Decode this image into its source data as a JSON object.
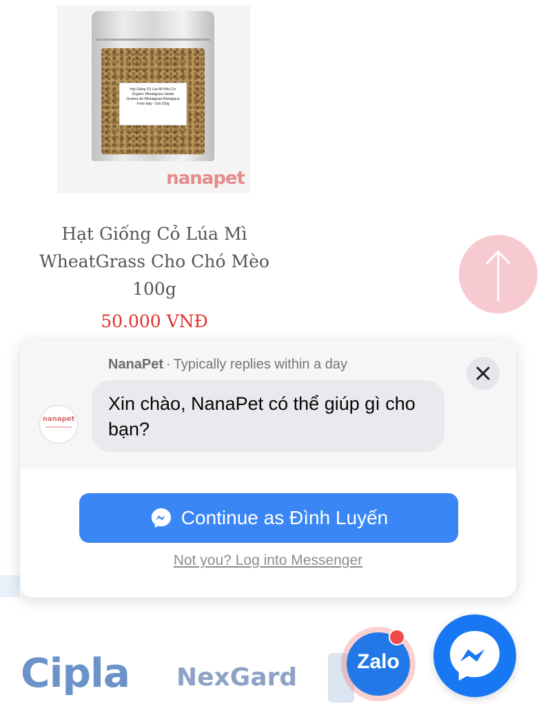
{
  "product": {
    "name": "Hạt Giống Cỏ Lúa Mì WheatGrass Cho Chó Mèo 100g",
    "price": "50.000 VNĐ",
    "image_label": "Hạt Giống Cỏ Lúa Mì Hữu Cơ\nOrganic Wheatgrass Seeds\nGraines de Wheatgrass Biologique\nFrom Italy - Gói 100g",
    "brand_watermark": "nanapet"
  },
  "chat_popup": {
    "page_name": "NanaPet",
    "separator": "·",
    "reply_time": "Typically replies within a day",
    "greeting": "Xin chào, NanaPet có thể giúp gì cho bạn?",
    "avatar_text": "nanapet",
    "continue_label": "Continue as Đình Luyến",
    "login_link": "Not you? Log into Messenger"
  },
  "partners": {
    "logo_1": "Cipla",
    "logo_2": "NexGard"
  },
  "zalo": {
    "label": "Zalo"
  },
  "icons": {
    "back_to_top": "arrow-up-icon",
    "close": "close-icon",
    "messenger": "messenger-icon"
  },
  "colors": {
    "price": "#e2312d",
    "messenger_blue": "#1877f2",
    "continue_button": "#3a86f5",
    "back_to_top": "#f7c9d0",
    "zalo": "#2378e8"
  }
}
